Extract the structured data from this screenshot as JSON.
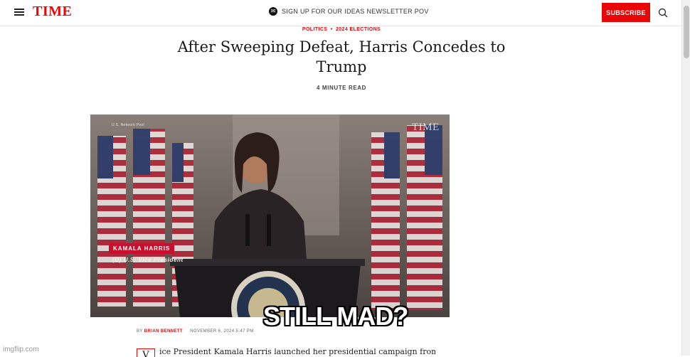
{
  "header": {
    "logo": "TIME",
    "newsletter_text": "SIGN UP FOR OUR IDEAS NEWSLETTER POV",
    "subscribe_label": "SUBSCRIBE"
  },
  "article": {
    "kicker_section": "POLITICS",
    "kicker_separator": "•",
    "kicker_topic": "2024 ELECTIONS",
    "headline": "After Sweeping Defeat, Harris Concedes to Trump",
    "read_time": "4 MINUTE READ",
    "hero": {
      "source_credit": "U.S. Network Pool",
      "watermark": "TIME",
      "lower_third_name": "KAMALA HARRIS",
      "lower_third_title": "(D) U.S. Vice President"
    },
    "byline_prefix": "BY",
    "author": "BRIAN BENNETT",
    "date": "NOVEMBER 6, 2024 5:47 PM",
    "dropcap": "V",
    "body_first_line": "ice President Kamala Harris launched her presidential campaign from a"
  },
  "meme_caption": "STILL MAD?",
  "imgflip_watermark": "imgflip.com",
  "colors": {
    "brand_red": "#e90606",
    "lower_third_red": "#c8102e"
  }
}
